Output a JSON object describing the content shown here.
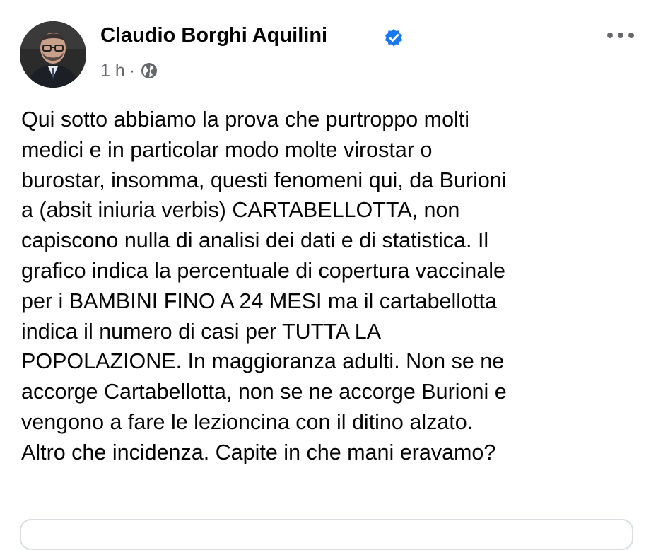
{
  "post": {
    "author": "Claudio Borghi Aquilini",
    "time": "1 h",
    "separator": "·",
    "body": "Qui sotto abbiamo la prova che purtroppo molti\nmedici e in particolar modo molte virostar o\nburostar, insomma, questi fenomeni qui, da Burioni\na (absit iniuria verbis) CARTABELLOTTA, non\ncapiscono nulla di analisi dei dati e di statistica. Il\ngrafico indica la percentuale di copertura vaccinale\nper i BAMBINI FINO A 24 MESI ma il cartabellotta\nindica il numero di casi per TUTTA LA\nPOPOLAZIONE. In maggioranza adulti. Non se ne\naccorge Cartabellotta, non se ne accorge Burioni e\nvengono a fare le lezioncina con il ditino alzato.\nAltro che incidenza. Capite in che mani eravamo?"
  },
  "icons": {
    "verified": "verified-badge-icon",
    "audience": "globe-icon",
    "more": "more-options-icon"
  },
  "colors": {
    "verified_blue": "#1877f2",
    "meta_gray": "#65676b",
    "text": "#050505"
  }
}
